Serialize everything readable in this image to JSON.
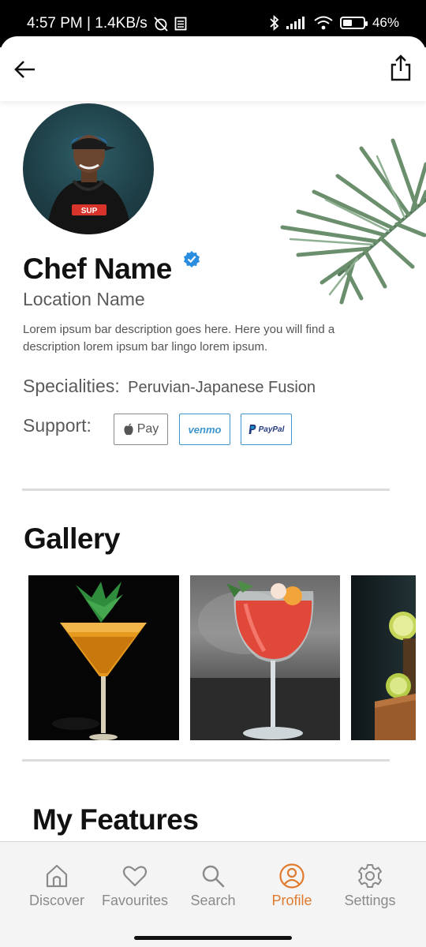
{
  "status_bar": {
    "time_speed": "4:57 PM | 1.4KB/s",
    "battery_text": "46%",
    "battery_level": 0.46
  },
  "icons": {
    "back": "arrow-left-icon",
    "share": "share-icon",
    "verified": "verified-badge-icon"
  },
  "profile": {
    "name": "Chef Name",
    "location": "Location Name",
    "description": "Lorem ipsum bar description goes here. Here you will find a description lorem ipsum bar lingo lorem ipsum.",
    "specialities_label": "Specialities:",
    "specialities_value": "Peruvian-Japanese Fusion",
    "support_label": "Support:",
    "payment_options": {
      "apple_pay": "Pay",
      "venmo": "venmo",
      "paypal": "PayPal"
    }
  },
  "gallery": {
    "title": "Gallery"
  },
  "features": {
    "title": "My Features"
  },
  "bottom_nav": {
    "items": [
      {
        "label": "Discover",
        "icon": "home-icon"
      },
      {
        "label": "Favourites",
        "icon": "heart-icon"
      },
      {
        "label": "Search",
        "icon": "search-icon"
      },
      {
        "label": "Profile",
        "icon": "user-circle-icon"
      },
      {
        "label": "Settings",
        "icon": "gear-icon"
      }
    ],
    "active_index": 3
  },
  "colors": {
    "accent": "#e07a2e",
    "inactive": "#8a8a8a",
    "verified": "#2a8de0",
    "payment_border": "#3d95ce"
  }
}
